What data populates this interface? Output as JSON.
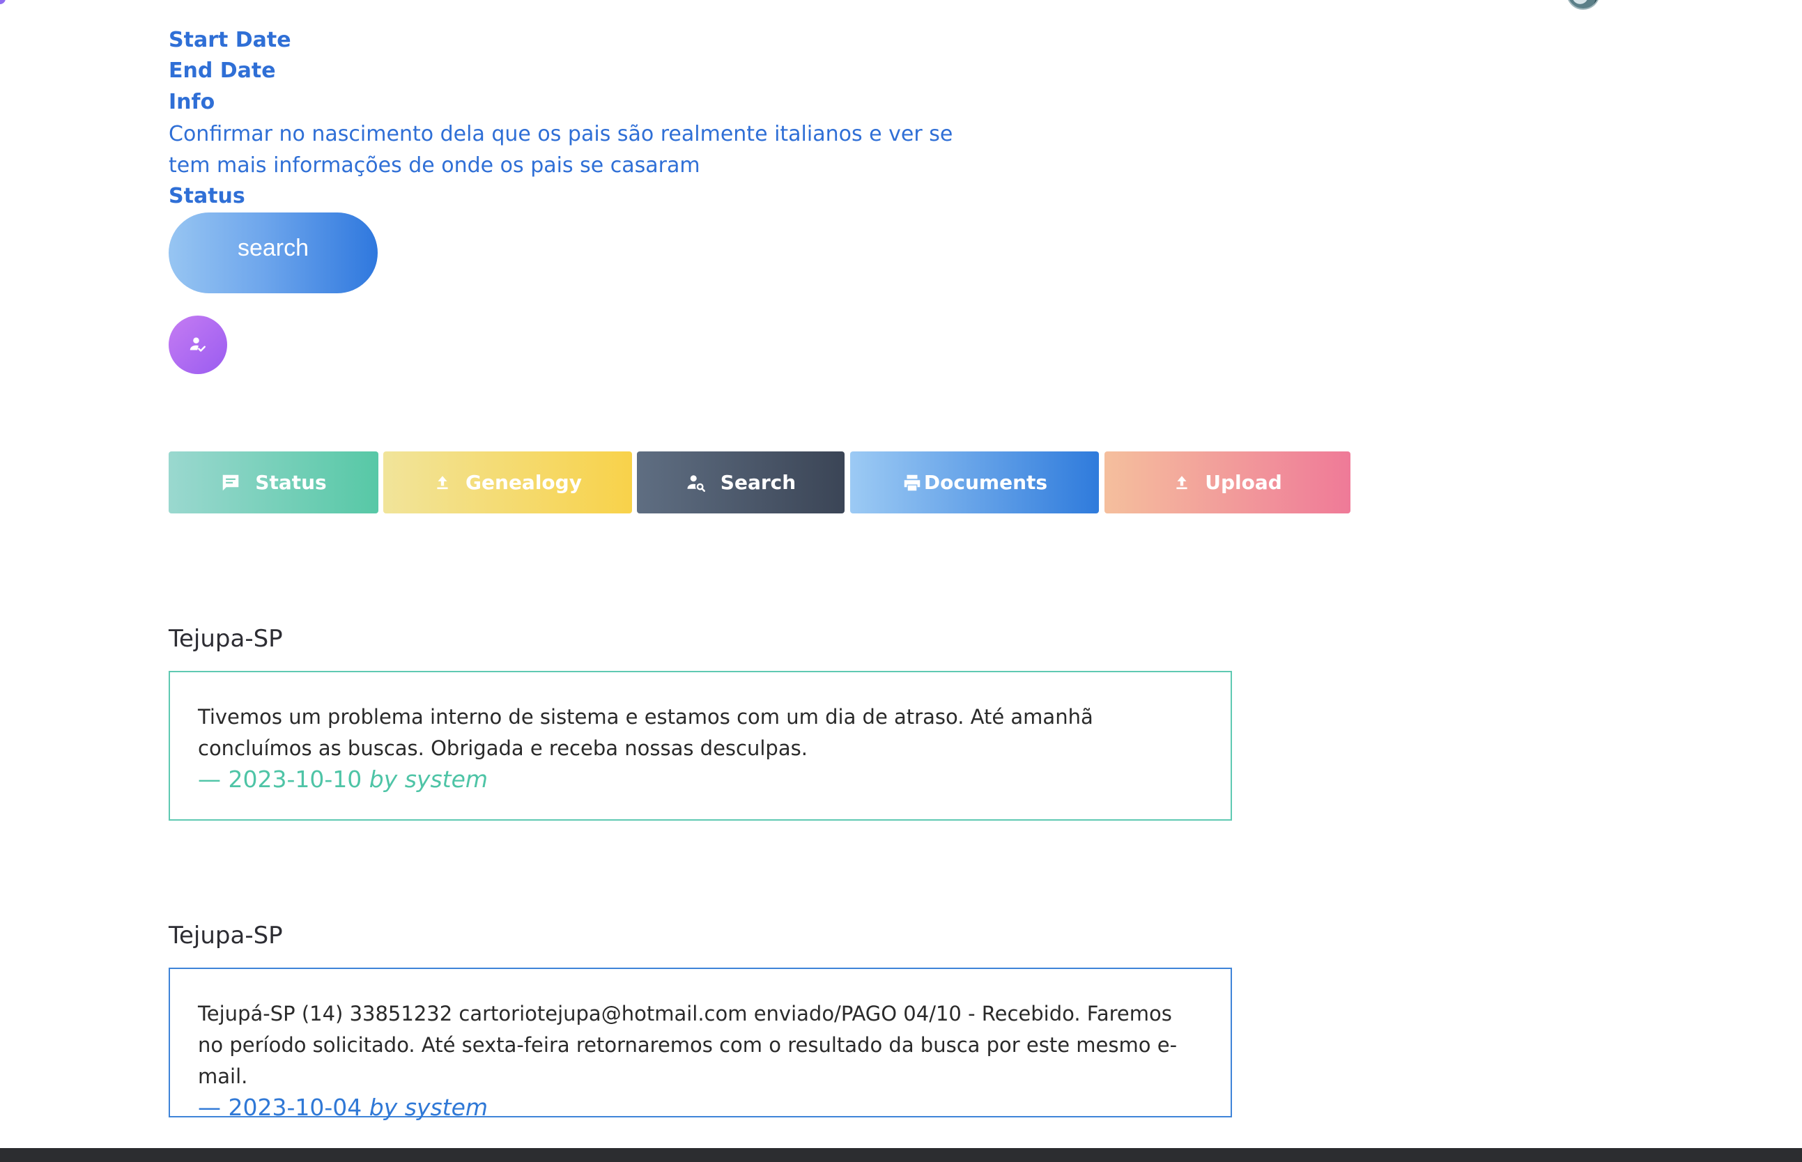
{
  "fields": {
    "start_date_label": "Start Date",
    "end_date_label": "End Date",
    "info_label": "Info",
    "info_text": "Confirmar no nascimento dela que os pais são realmente italianos e ver se tem mais informações de onde os pais se casaram",
    "status_label": "Status"
  },
  "search_button": {
    "label": "search"
  },
  "assign_button": {
    "icon": "person-check-icon"
  },
  "tabs": [
    {
      "label": "Status",
      "icon": "comment-icon"
    },
    {
      "label": "Genealogy",
      "icon": "upload-icon"
    },
    {
      "label": "Search",
      "icon": "person-search-icon"
    },
    {
      "label": "Documents",
      "icon": "printer-icon"
    },
    {
      "label": "Upload",
      "icon": "upload-icon"
    }
  ],
  "notes": [
    {
      "title": "Tejupa-SP",
      "text": "Tivemos um problema interno de sistema e estamos com um dia de atraso. Até amanhã concluímos as buscas. Obrigada e receba nossas desculpas.",
      "date": "— 2023-10-10",
      "author": "by system",
      "accent": "#5fc9b2"
    },
    {
      "title": "Tejupa-SP",
      "text": "Tejupá-SP (14) 33851232 cartoriotejupa@hotmail.com enviado/PAGO 04/10 - Recebido. Faremos no período solicitado. Até sexta-feira retornaremos com o resultado da busca por este mesmo e-mail.",
      "date": "— 2023-10-04",
      "author": "by system",
      "accent": "#3f84d8"
    }
  ],
  "colors": {
    "label_blue": "#2f6fd6",
    "footer": "#2c2d30"
  }
}
